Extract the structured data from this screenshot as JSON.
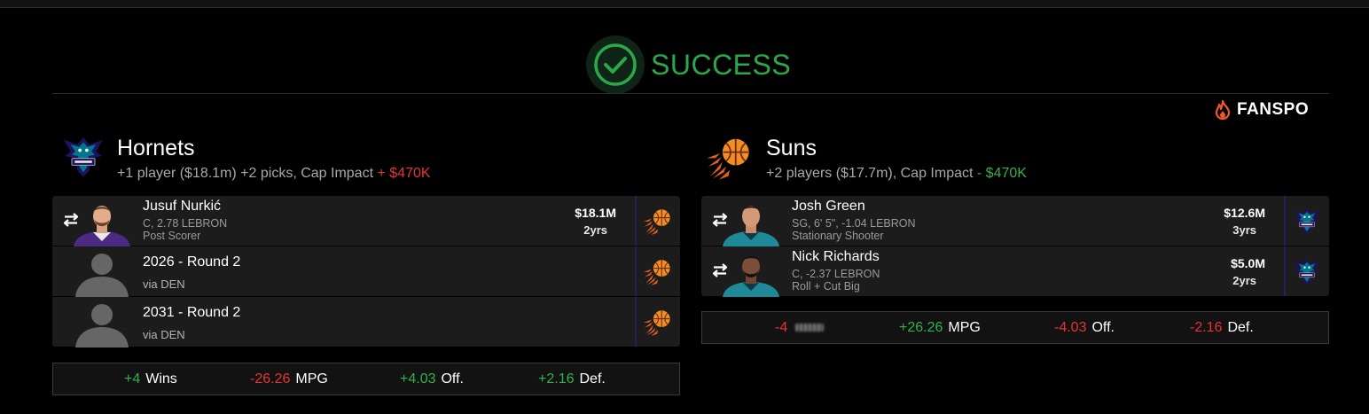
{
  "banner": {
    "status": "SUCCESS",
    "brand": "FANSPO"
  },
  "colors": {
    "success": "#2aa84a",
    "negative": "#e53434",
    "positive": "#34b04c",
    "divider": "#23205e"
  },
  "teams": [
    {
      "name": "Hornets",
      "logo_icon": "hornets-logo",
      "summary_prefix": "+1 player ($18.1m) +2 picks, Cap Impact",
      "cap_impact": "+ $470K",
      "assets": [
        {
          "type": "player",
          "name": "Jusuf Nurkić",
          "details": "C, 2.78 LEBRON",
          "role": "Post Scorer",
          "salary": "$18.1M",
          "years": "2yrs",
          "to": "suns-logo"
        },
        {
          "type": "pick",
          "name": "2026 - Round 2",
          "via": "via DEN",
          "to": "suns-logo"
        },
        {
          "type": "pick",
          "name": "2031 - Round 2",
          "via": "via DEN",
          "to": "suns-logo"
        }
      ],
      "stats": [
        {
          "value": "+4",
          "label": "Wins"
        },
        {
          "value": "-26.26",
          "label": "MPG"
        },
        {
          "value": "+4.03",
          "label": "Off."
        },
        {
          "value": "+2.16",
          "label": "Def."
        }
      ]
    },
    {
      "name": "Suns",
      "logo_icon": "suns-logo",
      "summary_prefix": "+2 players ($17.7m), Cap Impact",
      "cap_impact": "- $470K",
      "assets": [
        {
          "type": "player",
          "name": "Josh Green",
          "details": "SG, 6' 5\", -1.04 LEBRON",
          "role": "Stationary Shooter",
          "salary": "$12.6M",
          "years": "3yrs",
          "to": "hornets-logo"
        },
        {
          "type": "player",
          "name": "Nick Richards",
          "details": "C, -2.37 LEBRON",
          "role": "Roll + Cut Big",
          "salary": "$5.0M",
          "years": "2yrs",
          "to": "hornets-logo"
        }
      ],
      "stats": [
        {
          "value": "-4",
          "label": ""
        },
        {
          "value": "+26.26",
          "label": "MPG"
        },
        {
          "value": "-4.03",
          "label": "Off."
        },
        {
          "value": "-2.16",
          "label": "Def."
        }
      ]
    }
  ]
}
